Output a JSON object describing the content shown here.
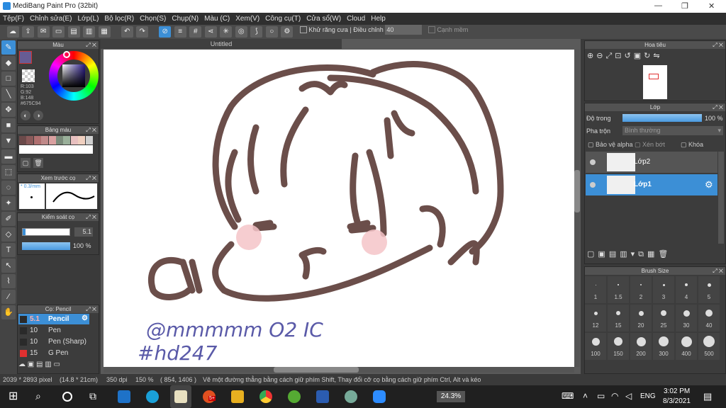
{
  "window": {
    "title": "MediBang Paint Pro (32bit)",
    "minimize": "—",
    "maximize": "❐",
    "close": "✕"
  },
  "menu": [
    "Tệp(F)",
    "Chỉnh sửa(E)",
    "Lớp(L)",
    "Bộ lọc(R)",
    "Chọn(S)",
    "Chụp(N)",
    "Màu (C)",
    "Xem(V)",
    "Công cụ(T)",
    "Cửa sổ(W)",
    "Cloud",
    "Help"
  ],
  "toolbar": {
    "antialias_label": "Khử răng cưa",
    "adjust_label": "Điều chỉnh",
    "adjust_value": "40",
    "smooth_label": "Cạnh mềm"
  },
  "color_panel": {
    "title": "Màu",
    "r": "R:103",
    "g": "G:92",
    "b": "B:148",
    "hex": "#675C94",
    "primary_color": "#675C94"
  },
  "palette_panel": {
    "title": "Bảng màu",
    "swatches": [
      "#6b4a4a",
      "#8a5a5a",
      "#b07070",
      "#c08a8a",
      "#d9a0a0",
      "#7a8a7a",
      "#9ab09a",
      "#e8c0c0",
      "#f0d0c0",
      "#d0d0d0"
    ]
  },
  "preview_panel": {
    "title": "Xem trước cọ",
    "size_label": "* 0.3/mm"
  },
  "control_panel": {
    "title": "Kiểm soát cọ",
    "size_value": "5.1",
    "opacity_value": "100 %"
  },
  "brush_panel": {
    "title": "Cọ: Pencil",
    "brushes": [
      {
        "size": "5.1",
        "name": "Pencil",
        "color": "#2a2a2a"
      },
      {
        "size": "10",
        "name": "Pen",
        "color": "#2a2a2a"
      },
      {
        "size": "10",
        "name": "Pen (Sharp)",
        "color": "#2a2a2a"
      },
      {
        "size": "15",
        "name": "G Pen",
        "color": "#e03030"
      }
    ]
  },
  "document": {
    "tab": "Untitled"
  },
  "canvas_text": {
    "line1": "@mmmmm O2 IC",
    "line2": "#hd247"
  },
  "navigator_panel": {
    "title": "Hoa tiêu"
  },
  "layer_panel": {
    "title": "Lớp",
    "opacity_label": "Độ trong",
    "opacity_value": "100 %",
    "blend_label": "Pha trộn",
    "blend_value": "Bình thường",
    "protect_alpha": "Bảo vệ alpha",
    "clipping": "Xén bớt",
    "lock": "Khóa",
    "layers": [
      {
        "name": "Lớp2"
      },
      {
        "name": "Lớp1"
      }
    ]
  },
  "brush_size_panel": {
    "title": "Brush Size",
    "sizes": [
      "1",
      "1.5",
      "2",
      "3",
      "4",
      "5",
      "12",
      "15",
      "20",
      "25",
      "30",
      "40",
      "100",
      "150",
      "200",
      "300",
      "400",
      "500"
    ]
  },
  "status": {
    "dimensions": "2039 * 2893 pixel",
    "physical": "(14.8 * 21cm)",
    "dpi": "350 dpi",
    "zoom": "150 %",
    "coords": "( 854, 1406 )",
    "hint": "Vẽ một đường thẳng bằng cách giữ phím Shift, Thay đổi cỡ cọ bằng cách giữ phím Ctrl, Alt và kéo"
  },
  "taskbar": {
    "battery": "24.3%",
    "lang": "ENG",
    "time": "3:02 PM",
    "date": "8/3/2021",
    "notif_count": "5+"
  }
}
